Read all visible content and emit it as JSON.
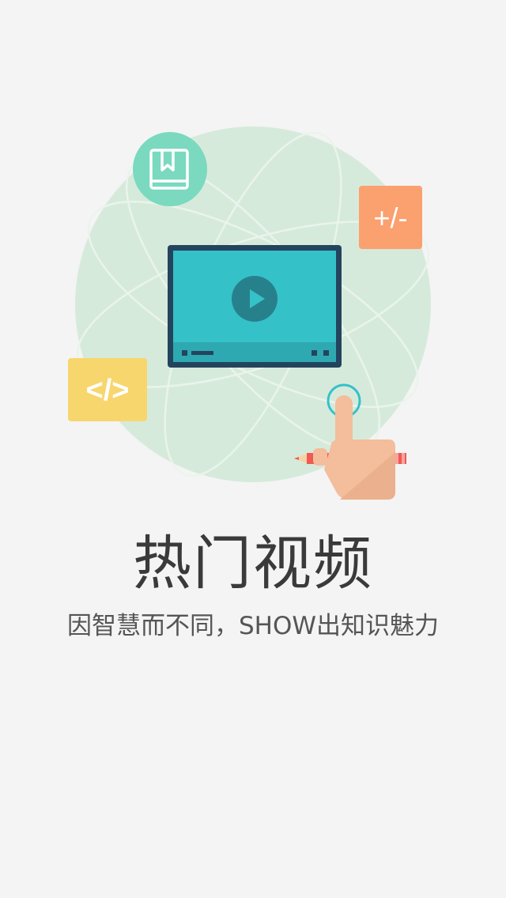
{
  "intro": {
    "title": "热门视频",
    "subtitle": "因智慧而不同，SHOW出知识魅力"
  },
  "icons": {
    "book": {
      "name": "book-icon",
      "color": "#7ad9bf"
    },
    "math": {
      "name": "plus-minus-icon",
      "label": "+/-",
      "color": "#fba06f"
    },
    "code": {
      "name": "code-icon",
      "label": "</>",
      "color": "#f8d66e"
    },
    "video": {
      "name": "video-player-icon",
      "color": "#35c1c8"
    },
    "hand": {
      "name": "pointing-hand-icon",
      "color": "#f4bd9b"
    },
    "pencil": {
      "name": "pencil-icon",
      "color": "#ef5a52"
    }
  },
  "colors": {
    "background": "#f4f4f4",
    "globe": "#d6eadb",
    "title": "#3a3a3a",
    "subtitle": "#555555"
  }
}
